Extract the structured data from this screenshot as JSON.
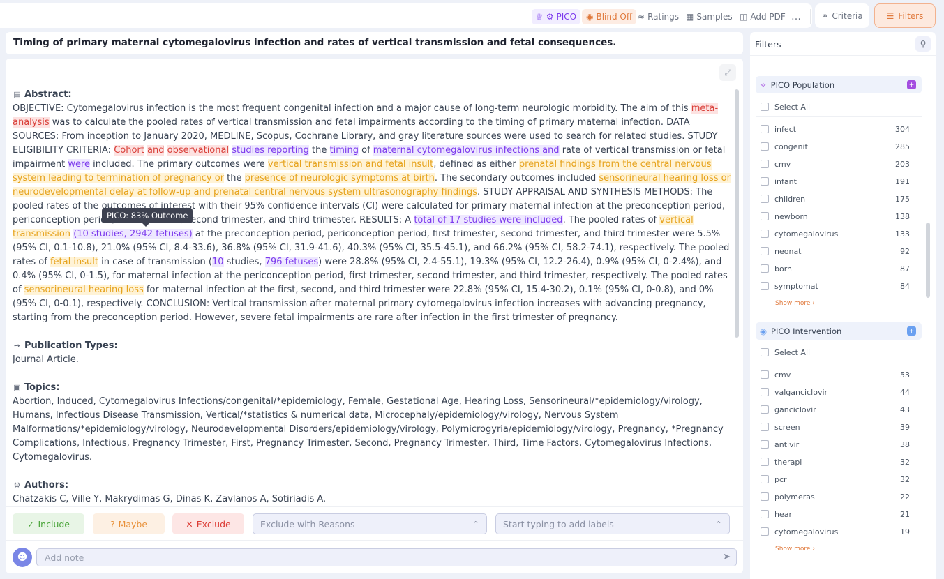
{
  "toolbar": {
    "pico": "PICO",
    "blind": "Blind Off",
    "ratings": "Ratings",
    "samples": "Samples",
    "add_pdf": "Add PDF",
    "more": "…",
    "criteria": "Criteria",
    "filters": "Filters"
  },
  "article": {
    "title": "Timing of primary maternal cytomegalovirus infection and rates of vertical transmission and fetal consequences.",
    "abstract_heading": "Abstract:",
    "abstract": {
      "s1": "OBJECTIVE: Cytomegalovirus infection is the most frequent congenital infection and a major cause of long-term neurologic morbidity. The aim of this ",
      "h1": "meta-analysis",
      "s2": " was to calculate the pooled rates of vertical transmission and fetal impairments according to the timing of primary maternal infection. DATA SOURCES: From inception to January 2020, MEDLINE, Scopus, Cochrane Library, and gray literature sources were used to search for related studies. STUDY ELIGIBILITY CRITERIA: ",
      "h2": "Cohort",
      "s3": " ",
      "h3": "and",
      "s4": " ",
      "h4": "observational",
      "s5": " ",
      "h5": "studies reporting",
      "s6": " the ",
      "h6": "timing",
      "s7": " of ",
      "h7": "maternal cytomegalovirus infections and",
      "s8": " rate of vertical transmission or fetal impairment ",
      "h8": "were",
      "s9": " included. The primary outcomes were ",
      "h9": "vertical transmission and fetal insult",
      "s10": ", defined as either ",
      "h10": "prenatal findings from the central nervous system leading to termination of pregnancy or",
      "s11": " the ",
      "h11": "presence of neurologic symptoms at birth",
      "s12": ". The secondary outcomes included ",
      "h12": "sensorineural hearing loss or neurodevelopmental delay at follow-up and prenatal central nervous system ultrasonography findings",
      "s13": ". STUDY APPRAISAL AND SYNTHESIS METHODS: The pooled rates of the outcomes of interest with their 95% confidence intervals (CI) were calculated for primary maternal infection at the preconception period, periconception period, first trimester, second trimester, and third trimester. RESULTS: A ",
      "h13": "total of 17 studies were included",
      "s14": ". The pooled rates of ",
      "h14": "vertical transmission",
      "s15": " ",
      "h15": "(10 studies, 2942 fetuses)",
      "s16": " at the preconception period, periconception period, first trimester, second trimester, and third trimester were 5.5% (95% CI, 0.1-10.8), 21.0% (95% CI, 8.4-33.6), 36.8% (95% CI, 31.9-41.6), 40.3% (95% CI, 35.5-45.1), and 66.2% (95% CI, 58.2-74.1), respectively. The pooled rates of ",
      "h16": "fetal insult",
      "s17": " in case of transmission (",
      "h17": "10",
      "s18": " studies, ",
      "h18": "796 fetuses",
      "s19": ") were 28.8% (95% CI, 2.4-55.1), 19.3% (95% CI, 12.2-26.4), 0.9% (95% CI, 0-2.4%), and 0.4% (95% CI, 0-1.5), for maternal infection at the periconception period, first trimester, second trimester, and third trimester, respectively. The pooled rates of ",
      "h19": "sensorineural hearing loss",
      "s20": " for maternal infection at the first, second, and third trimester were 22.8% (95% CI, 15.4-30.2), 0.1% (95% CI, 0-0.8), and 0% (95% CI, 0-0.1), respectively. CONCLUSION: Vertical transmission after maternal primary cytomegalovirus infection increases with advancing pregnancy, starting from the preconception period. However, severe fetal impairments are rare after infection in the first trimester of pregnancy."
    },
    "tooltip": "PICO: 83% Outcome",
    "pubtypes_heading": "Publication Types:",
    "pubtypes": "Journal Article.",
    "topics_heading": "Topics:",
    "topics": "Abortion, Induced, Cytomegalovirus Infections/congenital/*epidemiology, Female, Gestational Age, Hearing Loss, Sensorineural/*epidemiology/virology, Humans, Infectious Disease Transmission, Vertical/*statistics & numerical data, Microcephaly/epidemiology/virology, Nervous System Malformations/*epidemiology/virology, Neurodevelopmental Disorders/epidemiology/virology, Polymicrogyria/epidemiology/virology, Pregnancy, *Pregnancy Complications, Infectious, Pregnancy Trimester, First, Pregnancy Trimester, Second, Pregnancy Trimester, Third, Time Factors, Cytomegalovirus Infections, Cytomegalovirus.",
    "authors_heading": "Authors:",
    "authors": "Chatzakis C, Ville Y, Makrydimas G, Dinas K, Zavlanos A, Sotiriadis A."
  },
  "decision": {
    "include": "Include",
    "maybe": "Maybe",
    "exclude": "Exclude",
    "exclude_reasons_placeholder": "Exclude with Reasons",
    "labels_placeholder": "Start typing to add labels"
  },
  "note": {
    "placeholder": "Add note"
  },
  "filters": {
    "title": "Filters",
    "select_all": "Select All",
    "show_more": "Show more ›",
    "population": {
      "title": "PICO Population",
      "items": [
        {
          "term": "infect",
          "count": "304"
        },
        {
          "term": "congenit",
          "count": "285"
        },
        {
          "term": "cmv",
          "count": "203"
        },
        {
          "term": "infant",
          "count": "191"
        },
        {
          "term": "children",
          "count": "175"
        },
        {
          "term": "newborn",
          "count": "138"
        },
        {
          "term": "cytomegalovirus",
          "count": "133"
        },
        {
          "term": "neonat",
          "count": "92"
        },
        {
          "term": "born",
          "count": "87"
        },
        {
          "term": "symptomat",
          "count": "84"
        }
      ]
    },
    "intervention": {
      "title": "PICO Intervention",
      "items": [
        {
          "term": "cmv",
          "count": "53"
        },
        {
          "term": "valganciclovir",
          "count": "44"
        },
        {
          "term": "ganciclovir",
          "count": "43"
        },
        {
          "term": "screen",
          "count": "39"
        },
        {
          "term": "antivir",
          "count": "38"
        },
        {
          "term": "therapi",
          "count": "32"
        },
        {
          "term": "pcr",
          "count": "32"
        },
        {
          "term": "polymeras",
          "count": "22"
        },
        {
          "term": "hear",
          "count": "21"
        },
        {
          "term": "cytomegalovirus",
          "count": "19"
        }
      ]
    }
  },
  "colors": {
    "accent": "#e0793c",
    "pico": "#7c3aed",
    "include": "#4aa53a",
    "exclude": "#dc3c35"
  }
}
